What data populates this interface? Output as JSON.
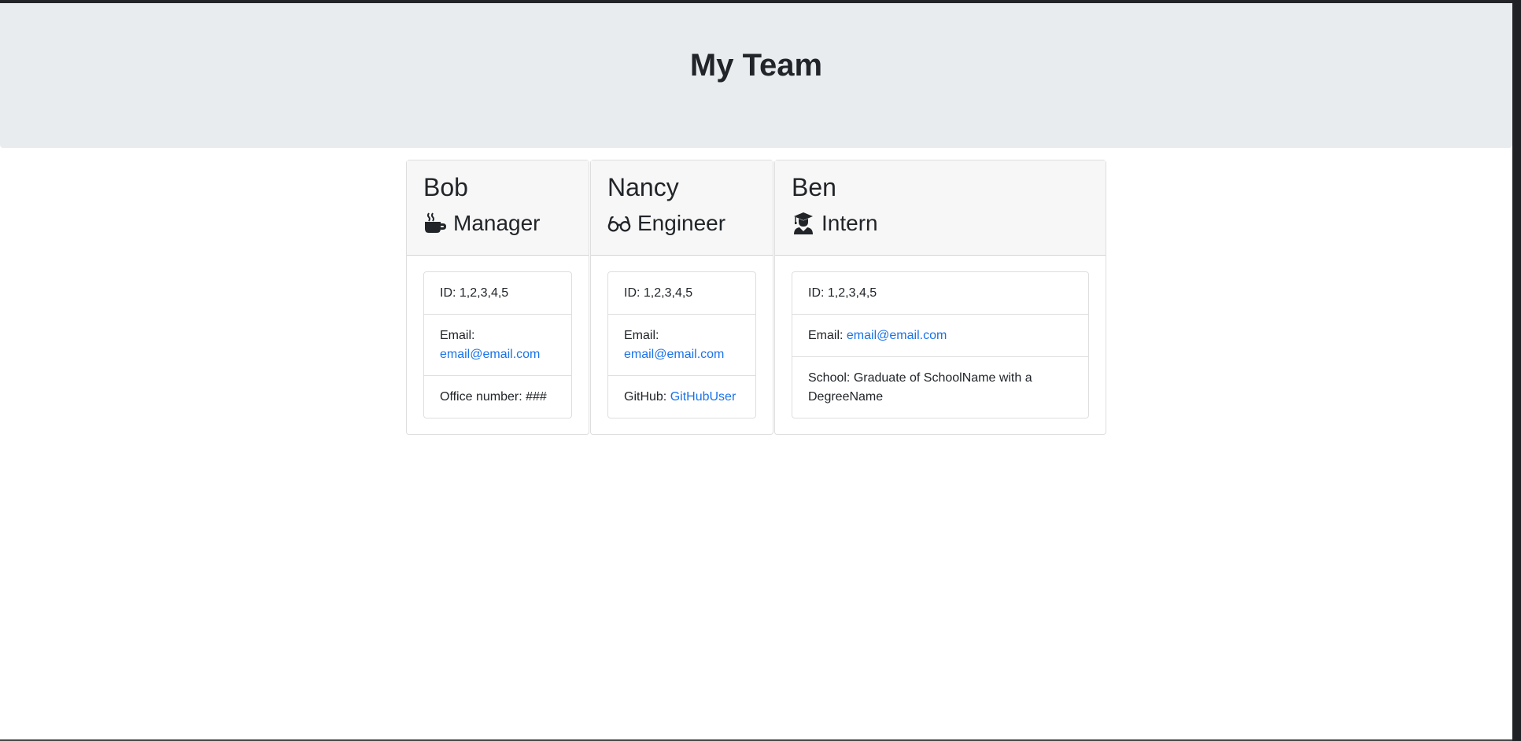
{
  "header": {
    "title": "My Team"
  },
  "employees": [
    {
      "name": "Bob",
      "role": "Manager",
      "icon": "coffee-icon",
      "id_label": "ID:",
      "id": "1,2,3,4,5",
      "email_label": "Email:",
      "email": "email@email.com",
      "extra_label": "Office number:",
      "extra_value": "###"
    },
    {
      "name": "Nancy",
      "role": "Engineer",
      "icon": "glasses-icon",
      "id_label": "ID:",
      "id": "1,2,3,4,5",
      "email_label": "Email:",
      "email": "email@email.com",
      "extra_label": "GitHub:",
      "extra_value": "GitHubUser"
    },
    {
      "name": "Ben",
      "role": "Intern",
      "icon": "graduate-icon",
      "id_label": "ID:",
      "id": "1,2,3,4,5",
      "email_label": "Email:",
      "email": "email@email.com",
      "extra_label": "School:",
      "extra_value": "Graduate of SchoolName with a DegreeName"
    }
  ],
  "colors": {
    "jumbotron_bg": "#e9ecef",
    "card_header_bg": "#f7f7f7",
    "link": "#1a73e8",
    "text": "#212529"
  }
}
